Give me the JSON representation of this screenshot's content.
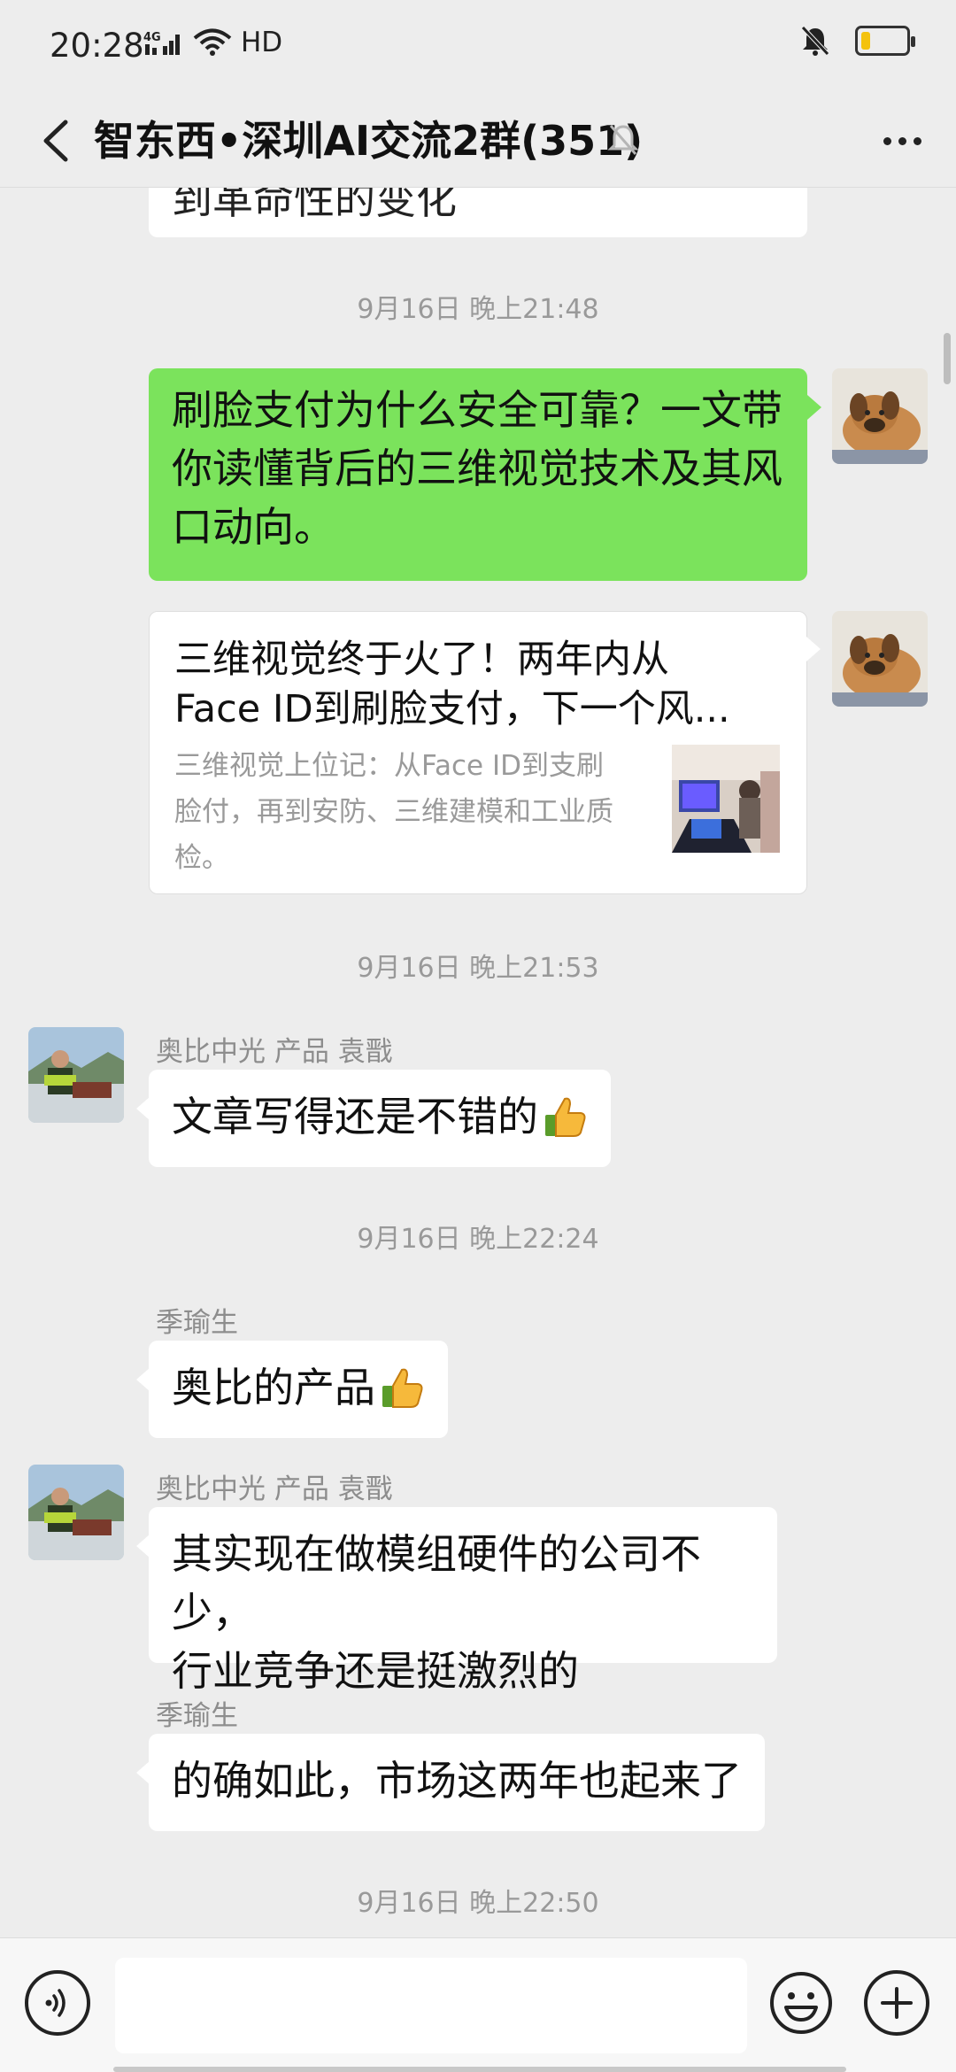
{
  "status_bar": {
    "time": "20:28",
    "network": "4G",
    "hd": "HD",
    "battery_level_percent": 20,
    "battery_color": "#f4c20d"
  },
  "header": {
    "title": "智东西•深圳AI交流2群(351)",
    "back_icon": "chevron-left-icon",
    "mute_icon": "bell-off-icon",
    "more_icon": "more-dots-icon"
  },
  "messages": {
    "partial_top_text": "到革命性的变化",
    "time_1": "9月16日 晚上21:48",
    "my_text_1": [
      "刷脸支付为什么安全可靠？一文带",
      "你读懂背后的三维视觉技术及其风",
      "口动向。"
    ],
    "card": {
      "title_line1": "三维视觉终于火了！两年内从",
      "title_line2": "Face ID到刷脸支付，下一个风...",
      "desc_line1": "三维视觉上位记：从Face ID到支刷",
      "desc_line2": "脸付，再到安防、三维建模和工业质",
      "desc_line3": "检。"
    },
    "time_2": "9月16日 晚上21:53",
    "msg_a_sender": "奥比中光 产品  袁戬",
    "msg_a_text": "文章写得还是不错的",
    "time_3": "9月16日 晚上22:24",
    "msg_b_sender": "季瑜生",
    "msg_b_text": "奥比的产品",
    "msg_c_sender": "奥比中光 产品  袁戬",
    "msg_c_text_1": "其实现在做模组硬件的公司不少，",
    "msg_c_text_2": "行业竞争还是挺激烈的",
    "msg_d_sender": "季瑜生",
    "msg_d_text": "的确如此，市场这两年也起来了",
    "time_4": "9月16日 晚上22:50"
  },
  "input_bar": {
    "voice_icon": "voice-icon",
    "emoji_icon": "smiley-icon",
    "plus_icon": "plus-icon",
    "input_value": ""
  },
  "colors": {
    "background": "#ededed",
    "my_bubble": "#7be35c",
    "other_bubble": "#ffffff",
    "timestamp": "#999999"
  }
}
